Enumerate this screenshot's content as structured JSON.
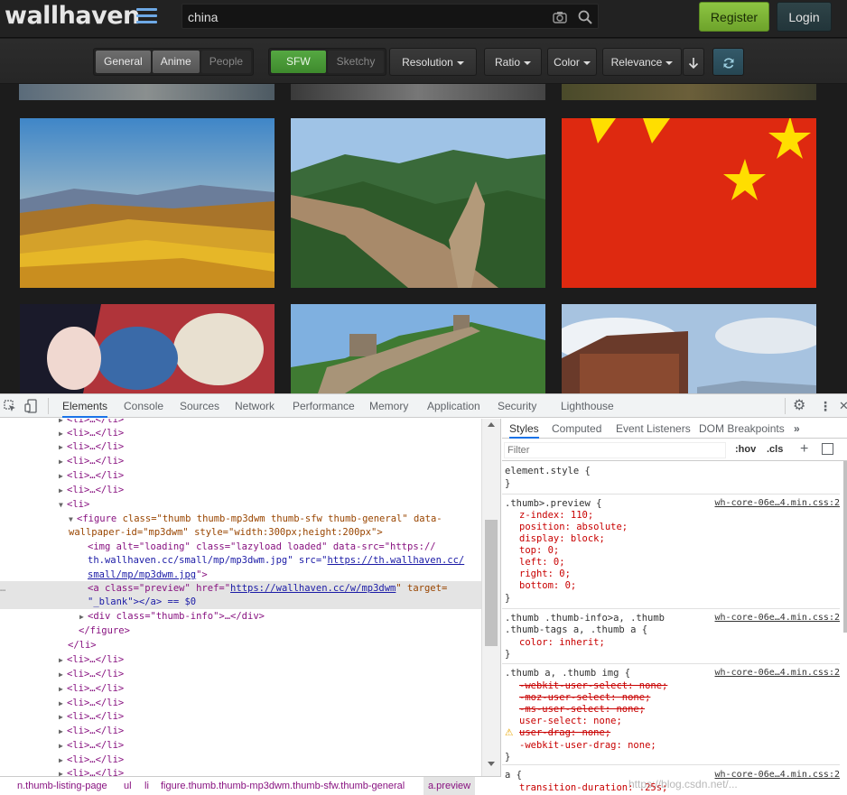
{
  "site": {
    "logo": "wallhaven",
    "search": {
      "value": "china"
    },
    "buttons": {
      "register": "Register",
      "login": "Login"
    },
    "filters": {
      "categories": [
        {
          "label": "General",
          "active": true
        },
        {
          "label": "Anime",
          "active": true
        },
        {
          "label": "People",
          "active": false
        }
      ],
      "purity": [
        {
          "label": "SFW",
          "active": true
        },
        {
          "label": "Sketchy",
          "active": false
        }
      ],
      "dropdowns": [
        "Resolution",
        "Ratio",
        "Color",
        "Relevance"
      ]
    }
  },
  "devtools": {
    "tabs": [
      "Elements",
      "Console",
      "Sources",
      "Network",
      "Performance",
      "Memory",
      "Application",
      "Security",
      "Lighthouse"
    ],
    "active_tab": "Elements",
    "elements": {
      "collapsed_li": "<li>…</li>",
      "open_li": "<li>",
      "figure_line1_tag": "<figure",
      "figure_line1_attrs": " class=\"thumb thumb-mp3dwm thumb-sfw thumb-general\" data-",
      "figure_line2": "wallpaper-id=\"mp3dwm\" style=\"width:300px;height:200px\">",
      "img_line1": "<img alt=\"loading\" class=\"lazyload loaded\" data-src=\"https://",
      "img_line2_pre": "th.wallhaven.cc/small/mp/mp3dwm.jpg\" src=\"",
      "img_line2_link": "https://th.wallhaven.cc/",
      "img_line3_link": "small/mp/mp3dwm.jpg",
      "img_line3_post": "\">",
      "a_line1_pre": "<a class=\"preview\" href=\"",
      "a_line1_link": "https://wallhaven.cc/w/mp3dwm",
      "a_line1_post": "\" target=",
      "a_line2": "\"_blank\"></a> == $0",
      "div_line": "<div class=\"thumb-info\">…</div>",
      "close_figure": "</figure>",
      "close_li": "</li>"
    },
    "breadcrumb": [
      "n.thumb-listing-page",
      "ul",
      "li",
      "figure.thumb.thumb-mp3dwm.thumb-sfw.thumb-general",
      "a.preview"
    ],
    "styles": {
      "tabs": [
        "Styles",
        "Computed",
        "Event Listeners",
        "DOM Breakpoints"
      ],
      "filter_placeholder": "Filter",
      "hov": ":hov",
      "cls": ".cls",
      "element_style": "element.style {",
      "close_brace": "}",
      "rule1": {
        "selector": ".thumb>.preview {",
        "source": "wh-core-06e…4.min.css:2",
        "props": [
          "z-index: 110;",
          "position: absolute;",
          "display: block;",
          "top: 0;",
          "left: 0;",
          "right: 0;",
          "bottom: 0;"
        ]
      },
      "rule2": {
        "selector1": ".thumb .thumb-info>a, .thumb",
        "selector2": ".thumb-tags a, .thumb a {",
        "source": "wh-core-06e…4.min.css:2",
        "props": [
          "color: inherit;"
        ]
      },
      "rule3": {
        "selector": ".thumb a, .thumb img {",
        "source": "wh-core-06e…4.min.css:2",
        "struck": [
          "-webkit-user-select: none;",
          "-moz-user-select: none;",
          "-ms-user-select: none;"
        ],
        "props": [
          "user-select: none;"
        ],
        "warn": "user-drag: none;",
        "last": "-webkit-user-drag: none;"
      },
      "rule4": {
        "selector": "a {",
        "source": "wh-core-06e…4.min.css:2",
        "props": [
          "transition-duration: .25s;"
        ]
      }
    },
    "watermark": "https://blog.csdn.net/..."
  }
}
